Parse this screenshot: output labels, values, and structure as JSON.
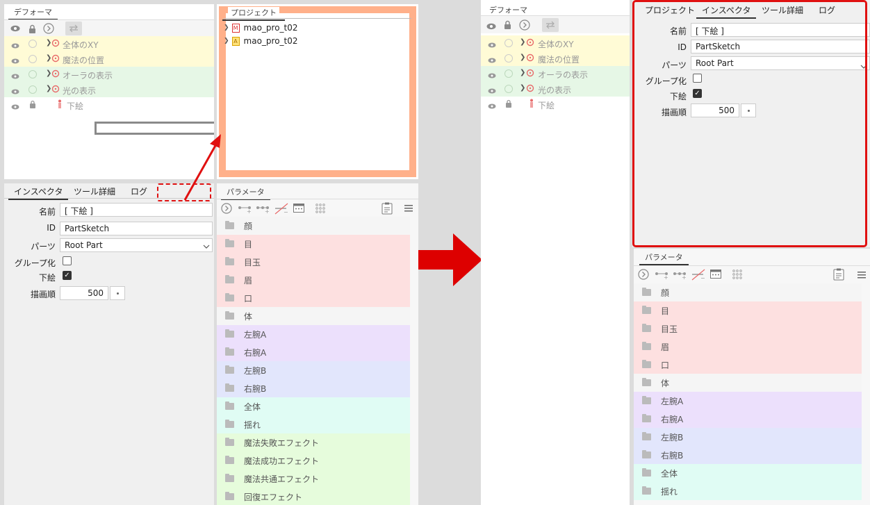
{
  "left": {
    "deformer": {
      "tab": "デフォーマ",
      "icons": [
        "eye-icon",
        "lock-icon",
        "circle-arrow-icon",
        "swap-icon"
      ],
      "rows": [
        {
          "label": "全体のXY",
          "bg": "#fffbd6"
        },
        {
          "label": "魔法の位置",
          "bg": "#fffbd6"
        },
        {
          "label": "オーラの表示",
          "bg": "#e6f7e6"
        },
        {
          "label": "光の表示",
          "bg": "#e6f7e6"
        },
        {
          "label": "下絵",
          "bg": "#ffffff"
        }
      ]
    },
    "project": {
      "tab": "プロジェクト",
      "items": [
        "mao_pro_t02",
        "mao_pro_t02"
      ]
    },
    "inspector": {
      "tabs": [
        "インスペクタ",
        "ツール詳細",
        "ログ"
      ],
      "name_label": "名前",
      "name_value": "[ 下絵 ]",
      "id_label": "ID",
      "id_value": "PartSketch",
      "parts_label": "パーツ",
      "parts_value": "Root Part",
      "group_label": "グループ化",
      "sketch_label": "下絵",
      "order_label": "描画順",
      "order_value": "500"
    },
    "params": {
      "tab": "パラメータ",
      "rows": [
        {
          "label": "顔",
          "bg": "#f5f5f5"
        },
        {
          "label": "目",
          "bg": "#fde0e0"
        },
        {
          "label": "目玉",
          "bg": "#fde0e0"
        },
        {
          "label": "眉",
          "bg": "#fde0e0"
        },
        {
          "label": "口",
          "bg": "#fde0e0"
        },
        {
          "label": "体",
          "bg": "#f5f5f5"
        },
        {
          "label": "左腕A",
          "bg": "#ece0fc"
        },
        {
          "label": "右腕A",
          "bg": "#ece0fc"
        },
        {
          "label": "左腕B",
          "bg": "#e2e6fc"
        },
        {
          "label": "右腕B",
          "bg": "#e2e6fc"
        },
        {
          "label": "全体",
          "bg": "#e0fcf4"
        },
        {
          "label": "揺れ",
          "bg": "#e0fcf4"
        },
        {
          "label": "魔法失敗エフェクト",
          "bg": "#e6fcdc"
        },
        {
          "label": "魔法成功エフェクト",
          "bg": "#e6fcdc"
        },
        {
          "label": "魔法共通エフェクト",
          "bg": "#e6fcdc"
        },
        {
          "label": "回復エフェクト",
          "bg": "#e6fcdc"
        }
      ]
    }
  },
  "right": {
    "deformer": {
      "tab": "デフォーマ",
      "rows": [
        {
          "label": "全体のXY",
          "bg": "#fffbd6"
        },
        {
          "label": "魔法の位置",
          "bg": "#fffbd6"
        },
        {
          "label": "オーラの表示",
          "bg": "#e6f7e6"
        },
        {
          "label": "光の表示",
          "bg": "#e6f7e6"
        },
        {
          "label": "下絵",
          "bg": "#ffffff"
        }
      ]
    },
    "inspector": {
      "tabs": [
        "プロジェクト",
        "インスペクタ",
        "ツール詳細",
        "ログ"
      ],
      "name_label": "名前",
      "name_value": "[ 下絵 ]",
      "id_label": "ID",
      "id_value": "PartSketch",
      "parts_label": "パーツ",
      "parts_value": "Root Part",
      "group_label": "グループ化",
      "sketch_label": "下絵",
      "order_label": "描画順",
      "order_value": "500"
    },
    "params": {
      "tab": "パラメータ",
      "rows": [
        {
          "label": "顔",
          "bg": "#f5f5f5"
        },
        {
          "label": "目",
          "bg": "#fde0e0"
        },
        {
          "label": "目玉",
          "bg": "#fde0e0"
        },
        {
          "label": "眉",
          "bg": "#fde0e0"
        },
        {
          "label": "口",
          "bg": "#fde0e0"
        },
        {
          "label": "体",
          "bg": "#f5f5f5"
        },
        {
          "label": "左腕A",
          "bg": "#ece0fc"
        },
        {
          "label": "右腕A",
          "bg": "#ece0fc"
        },
        {
          "label": "左腕B",
          "bg": "#e2e6fc"
        },
        {
          "label": "右腕B",
          "bg": "#e2e6fc"
        },
        {
          "label": "全体",
          "bg": "#e0fcf4"
        },
        {
          "label": "揺れ",
          "bg": "#e0fcf4"
        }
      ]
    }
  },
  "colors": {
    "highlight_red": "#e01010",
    "project_orange": "#ffb08a",
    "arrow_red": "#dd0000"
  }
}
